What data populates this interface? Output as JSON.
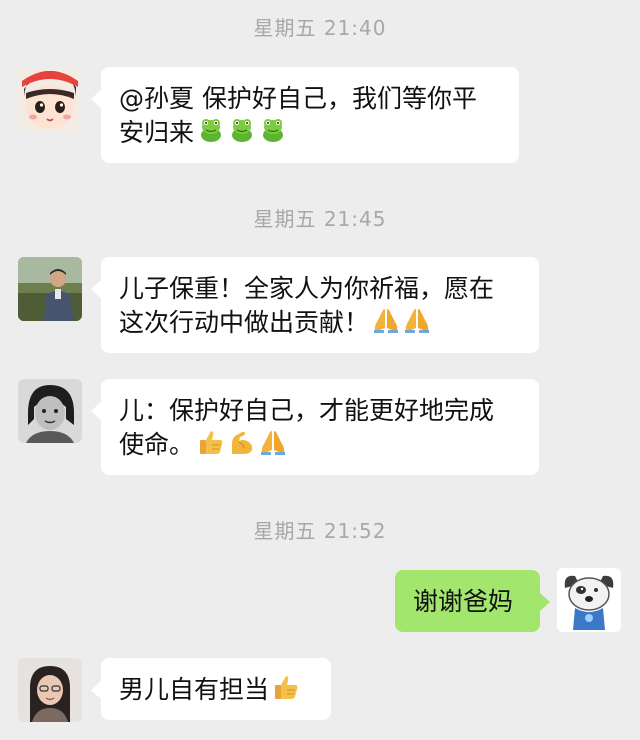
{
  "timestamps": [
    "星期五 21:40",
    "星期五 21:45",
    "星期五 21:52"
  ],
  "messages": [
    {
      "lines": [
        "@孙夏 保护好自己，我们等你平",
        "安归来"
      ],
      "emoji": [
        "frog-icon",
        "frog-icon",
        "frog-icon"
      ]
    },
    {
      "lines": [
        "儿子保重！全家人为你祈福，愿在",
        "这次行动中做出贡献！"
      ],
      "emoji": [
        "pray-icon",
        "pray-icon"
      ]
    },
    {
      "lines": [
        "儿：保护好自己，才能更好地完成",
        "使命。"
      ],
      "emoji": [
        "thumbs-up-icon",
        "flexed-arm-icon",
        "pray-icon"
      ]
    },
    {
      "lines": [
        "谢谢爸妈"
      ],
      "emoji": []
    },
    {
      "lines": [
        "男儿自有担当"
      ],
      "emoji": [
        "thumbs-up-icon"
      ]
    }
  ],
  "colors": {
    "background": "#ededed",
    "incoming_bubble": "#ffffff",
    "outgoing_bubble": "#a2e66d",
    "timestamp": "#a8a8a8"
  }
}
